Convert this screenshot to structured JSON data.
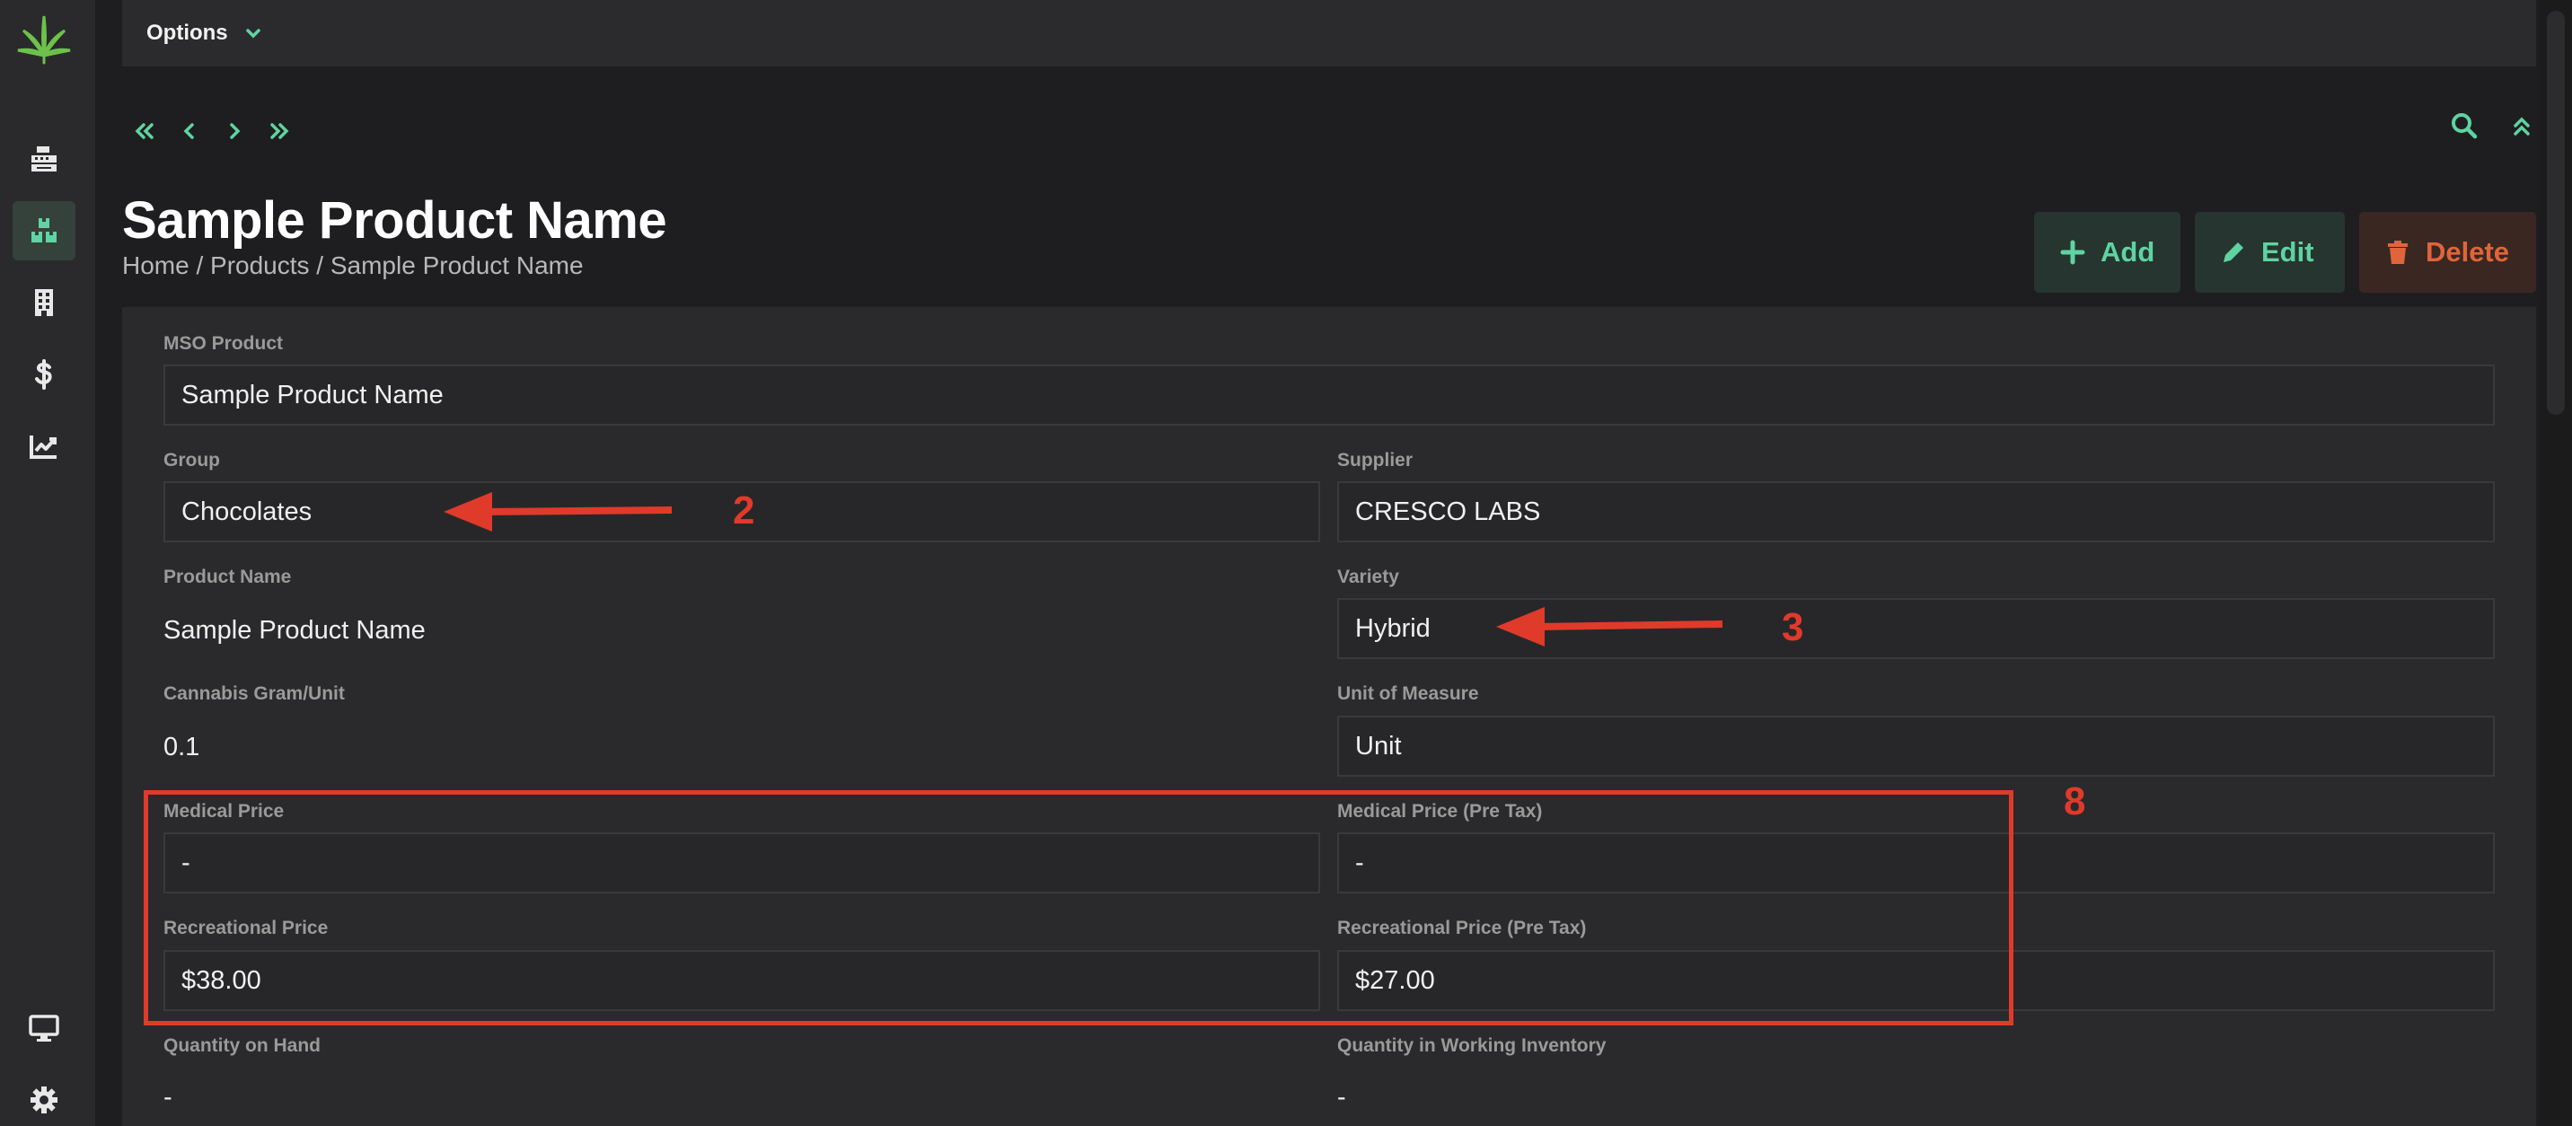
{
  "options_bar": {
    "label": "Options"
  },
  "sidebar": {
    "items": [
      {
        "icon": "cash-register-icon"
      },
      {
        "icon": "boxes-icon",
        "active": true
      },
      {
        "icon": "building-icon"
      },
      {
        "icon": "dollar-icon"
      },
      {
        "icon": "chart-line-icon"
      },
      {
        "icon": "desktop-icon"
      },
      {
        "icon": "gear-icon"
      }
    ]
  },
  "page": {
    "title": "Sample Product Name",
    "breadcrumb": "Home / Products / Sample Product Name"
  },
  "actions": {
    "add": "Add",
    "edit": "Edit",
    "delete": "Delete"
  },
  "form": {
    "mso_product": {
      "label": "MSO Product",
      "value": "Sample Product Name"
    },
    "group": {
      "label": "Group",
      "value": "Chocolates"
    },
    "supplier": {
      "label": "Supplier",
      "value": "CRESCO LABS"
    },
    "product_name": {
      "label": "Product Name",
      "value": "Sample Product Name"
    },
    "variety": {
      "label": "Variety",
      "value": "Hybrid"
    },
    "cannabis_gram": {
      "label": "Cannabis Gram/Unit",
      "value": "0.1"
    },
    "unit_of_measure": {
      "label": "Unit of Measure",
      "value": "Unit"
    },
    "medical_price": {
      "label": "Medical Price",
      "value": "-"
    },
    "medical_price_pre_tax": {
      "label": "Medical Price (Pre Tax)",
      "value": "-"
    },
    "recreational_price": {
      "label": "Recreational Price",
      "value": "$38.00"
    },
    "recreational_price_pre_tax": {
      "label": "Recreational Price (Pre Tax)",
      "value": "$27.00"
    },
    "quantity_on_hand": {
      "label": "Quantity on Hand",
      "value": "-"
    },
    "quantity_working": {
      "label": "Quantity in Working Inventory",
      "value": "-"
    }
  },
  "annotations": {
    "a2": "2",
    "a3": "3",
    "a8": "8"
  },
  "colors": {
    "accent": "#5fd3a2",
    "danger": "#e0653a",
    "annotation": "#e03a2a"
  }
}
